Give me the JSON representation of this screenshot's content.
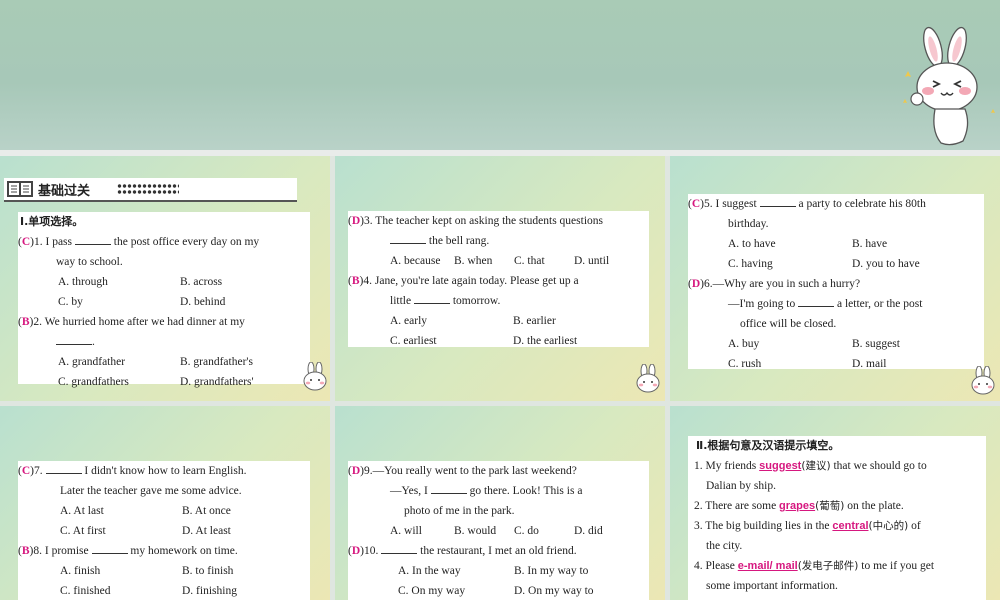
{
  "header": {
    "title": "基础过关"
  },
  "section1": {
    "title": "Ⅰ.单项选择。"
  },
  "questions": [
    {
      "ans": "C",
      "num": "1.",
      "pre": "I pass",
      "post": "the post office every day on my",
      "cont": "way to school.",
      "opts": [
        "A. through",
        "B. across",
        "C. by",
        "D. behind"
      ]
    },
    {
      "ans": "B",
      "num": "2.",
      "pre": "We hurried home after we had dinner at my",
      "post": "",
      "cont": ".",
      "opts": [
        "A. grandfather",
        "B. grandfather's",
        "C. grandfathers",
        "D. grandfathers'"
      ]
    },
    {
      "ans": "D",
      "num": "3.",
      "pre": "The teacher kept on asking the students questions",
      "post": "",
      "cont": "the bell rang.",
      "opts": [
        "A. because",
        "B. when",
        "C. that",
        "D. until"
      ]
    },
    {
      "ans": "B",
      "num": "4.",
      "pre": "Jane, you're late again today. Please get up a",
      "post": "",
      "cont": "tomorrow.",
      "cont_pre": "little",
      "opts": [
        "A. early",
        "B. earlier",
        "C. earliest",
        "D. the earliest"
      ]
    },
    {
      "ans": "C",
      "num": "5.",
      "pre": "I suggest",
      "post": "a party to celebrate his 80th",
      "cont": "birthday.",
      "opts": [
        "A. to have",
        "B. have",
        "C. having",
        "D. you to have"
      ]
    },
    {
      "ans": "D",
      "num": "6.",
      "pre": "—Why are you in such a hurry?",
      "post": "",
      "cont_pre": "—I'm going to",
      "cont": "a letter, or the post",
      "cont2": "office will be closed.",
      "opts": [
        "A. buy",
        "B. suggest",
        "C. rush",
        "D. mail"
      ]
    },
    {
      "ans": "C",
      "num": "7.",
      "post": "I didn't know how to learn English.",
      "cont": "Later the teacher gave me some advice.",
      "opts": [
        "A. At last",
        "B. At once",
        "C. At first",
        "D. At least"
      ]
    },
    {
      "ans": "B",
      "num": "8.",
      "pre": "I promise",
      "post": "my homework on time.",
      "opts": [
        "A. finish",
        "B. to finish",
        "C. finished",
        "D. finishing"
      ]
    },
    {
      "ans": "D",
      "num": "9.",
      "pre": "—You really went to the park last weekend?",
      "cont_pre": "—Yes, I",
      "cont": "go there. Look! This is a",
      "cont2": "photo of me in the park.",
      "opts": [
        "A. will",
        "B. would",
        "C. do",
        "D. did"
      ]
    },
    {
      "ans": "D",
      "num": "10.",
      "post": "the restaurant, I met an old friend.",
      "opts": [
        "A. In the way",
        "B. In my way to",
        "C. On my way",
        "D. On my way to"
      ]
    }
  ],
  "section2": {
    "title": "Ⅱ.根据句意及汉语提示填空。",
    "items": [
      {
        "pre": "1. My friends",
        "ans": "suggest",
        "hint": "(建议)",
        "post": "that we should go to",
        "cont": "Dalian by ship."
      },
      {
        "pre": "2. There are some",
        "ans": "grapes",
        "hint": "(葡萄)",
        "post": "on the plate.",
        "cont": ""
      },
      {
        "pre": "3. The big building lies in the",
        "ans": "central",
        "hint": "(中心的)",
        "post": "of",
        "cont": "the city."
      },
      {
        "pre": "4. Please",
        "ans": "e-mail/ mail",
        "hint": "(发电子邮件)",
        "post": "to me if you get",
        "cont": "some important information."
      }
    ]
  },
  "icons": {
    "bunny": "bunny-mascot-icon",
    "book": "book-icon"
  },
  "colors": {
    "answer": "#d6177f",
    "banner": "#a9cbb6"
  }
}
